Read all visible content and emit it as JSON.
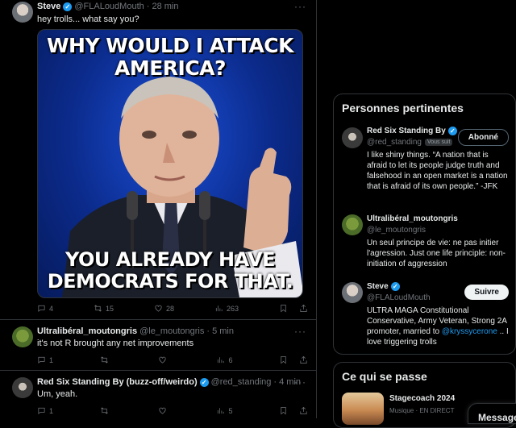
{
  "posts": [
    {
      "name": "Steve",
      "handle": "@FLALoudMouth",
      "time": "· 28 min",
      "text": "hey trolls... what say you?",
      "image": {
        "top_text": "WHY WOULD I ATTACK AMERICA?",
        "bottom_text": "YOU ALREADY HAVE DEMOCRATS FOR THAT."
      },
      "replies": "4",
      "reposts": "15",
      "likes": "28",
      "views": "263"
    },
    {
      "name": "Ultralibéral_moutongris",
      "handle": "@le_moutongris",
      "time": "· 5 min",
      "text": "it's not R brought any net improvements",
      "replies": "1",
      "reposts": "",
      "likes": "",
      "views": "6"
    },
    {
      "name": "Red Six Standing By (buzz-off/weirdo)",
      "handle": "@red_standing",
      "time": "· 4 min",
      "text": "Um, yeah.",
      "replies": "1",
      "reposts": "",
      "likes": "",
      "views": "5"
    }
  ],
  "more_label": "···",
  "relevant_people": {
    "title": "Personnes pertinentes",
    "people": [
      {
        "name": "Red Six Standing By",
        "handle": "@red_standing",
        "badge": "Vous suit",
        "button": "Abonné",
        "bio": "I like shiny things. “A nation that is afraid to let its people judge truth and falsehood in an open market is a nation that is afraid of its own people.” -JFK"
      },
      {
        "name": "Ultralibéral_moutongris",
        "handle": "@le_moutongris",
        "bio": "Un seul principe de vie: ne pas initier l'agression. Just one life principle: non-initiation of aggression"
      },
      {
        "name": "Steve",
        "handle": "@FLALoudMouth",
        "button": "Suivre",
        "bio_before": "ULTRA MAGA Constitutional Conservative, Army Veteran, Strong 2A promoter, married to ",
        "bio_mention": "@kryssycerone",
        "bio_after": " .. I love triggering trolls"
      }
    ]
  },
  "happening": {
    "title": "Ce qui se passe",
    "trend_title": "Stagecoach 2024",
    "trend_sub": "Musique · EN DIRECT"
  },
  "messages_label": "Message",
  "colors": {
    "accent": "#1d9bf0",
    "background": "#000000",
    "muted": "#71767b"
  }
}
